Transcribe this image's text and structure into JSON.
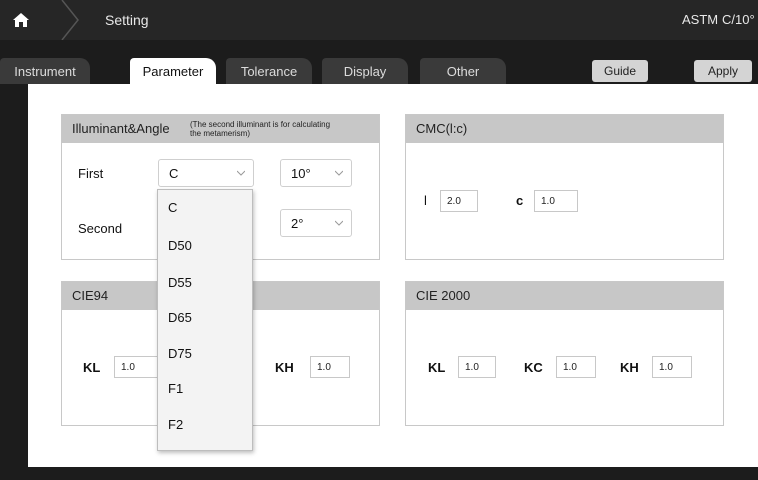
{
  "header": {
    "title": "Setting",
    "standard": "ASTM",
    "observer": "C/10°"
  },
  "tabs": [
    {
      "label": "Instrument"
    },
    {
      "label": "Parameter"
    },
    {
      "label": "Tolerance"
    },
    {
      "label": "Display"
    },
    {
      "label": "Other"
    }
  ],
  "active_tab": "Parameter",
  "buttons": {
    "guide": "Guide",
    "apply": "Apply"
  },
  "illuminant_panel": {
    "title": "Illuminant&Angle",
    "note_line1": "(The second illuminant is for calculating",
    "note_line2": "the metamerism)",
    "first_label": "First",
    "first_illuminant": "C",
    "first_angle": "10°",
    "second_label": "Second",
    "second_angle": "2°"
  },
  "cmc_panel": {
    "title": "CMC(l:c)",
    "l_label": "l",
    "l_value": "2.0",
    "c_label": "c",
    "c_value": "1.0"
  },
  "cie94_panel": {
    "title": "CIE94",
    "kl_label": "KL",
    "kl_value": "1.0",
    "kh_label": "KH",
    "kh_value": "1.0"
  },
  "cie2000_panel": {
    "title": "CIE 2000",
    "kl_label": "KL",
    "kl_value": "1.0",
    "kc_label": "KC",
    "kc_value": "1.0",
    "kh_label": "KH",
    "kh_value": "1.0"
  },
  "dropdown_options": [
    "C",
    "D50",
    "D55",
    "D65",
    "D75",
    "F1",
    "F2"
  ],
  "colors": {
    "topbar": "#262626",
    "tab_inactive": "#3a3a3a",
    "panel_header": "#c7c7c7",
    "button": "#d4d4d4"
  }
}
